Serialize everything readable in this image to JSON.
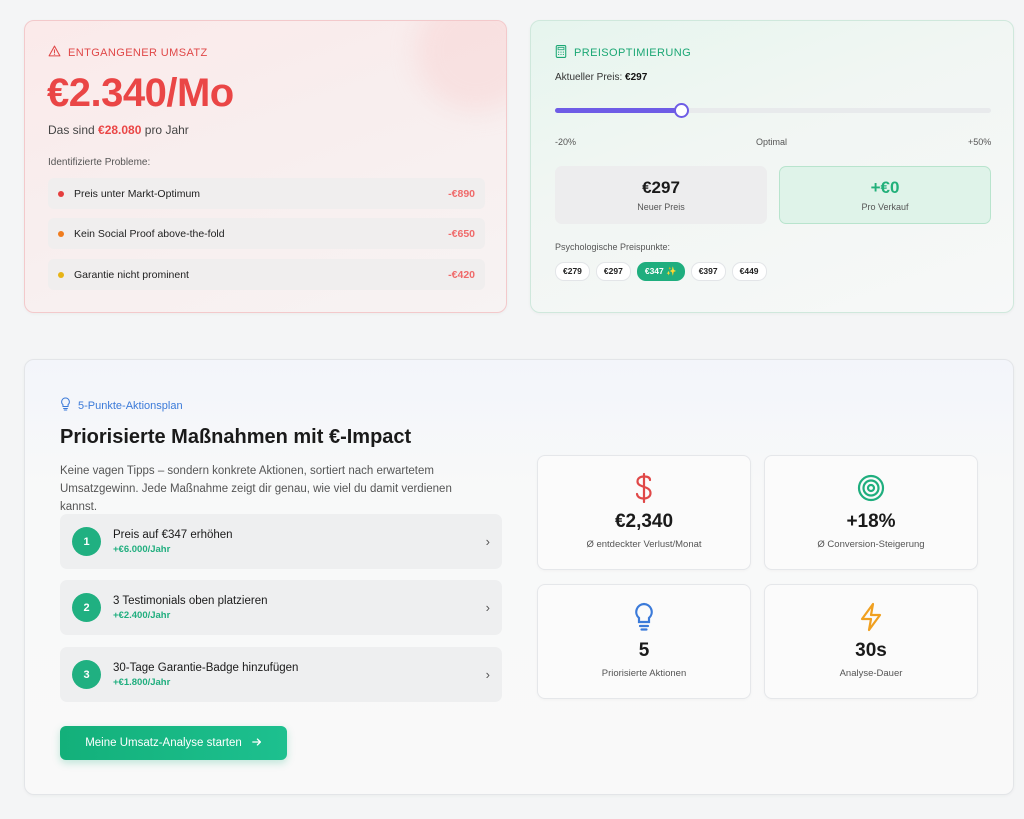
{
  "lost_revenue": {
    "heading": "ENTGANGENER UMSATZ",
    "amount": "€2.340/Mo",
    "sub_prefix": "Das sind",
    "sub_amount": "€28.080",
    "sub_suffix": "pro Jahr",
    "problems_label": "Identifizierte Probleme:",
    "problems": [
      {
        "label": "Preis unter Markt-Optimum",
        "amount": "-€890",
        "color": "#e53e3e"
      },
      {
        "label": "Kein Social Proof above-the-fold",
        "amount": "-€650",
        "color": "#f07c1e"
      },
      {
        "label": "Garantie nicht prominent",
        "amount": "-€420",
        "color": "#e7b416"
      }
    ]
  },
  "price_optimization": {
    "heading": "PREISOPTIMIERUNG",
    "current_label": "Aktueller Preis:",
    "current_value": "€297",
    "slider_value": 0.29,
    "slider_min_label": "-20%",
    "slider_mid_label": "Optimal",
    "slider_max_label": "+50%",
    "new_price": {
      "value": "€297",
      "label": "Neuer Preis"
    },
    "per_sale": {
      "value": "+€0",
      "label": "Pro Verkauf"
    },
    "psy_label": "Psychologische Preispunkte:",
    "psy_points": [
      "€279",
      "€297",
      "€347 ✨",
      "€397",
      "€449"
    ],
    "psy_active_index": 2
  },
  "action_plan": {
    "tag": "5-Punkte-Aktionsplan",
    "title": "Priorisierte Maßnahmen mit €-Impact",
    "description": "Keine vagen Tipps – sondern konkrete Aktionen, sortiert nach erwartetem Umsatzgewinn. Jede Maßnahme zeigt dir genau, wie viel du damit verdienen kannst.",
    "actions": [
      {
        "num": "1",
        "title": "Preis auf €347 erhöhen",
        "impact": "+€6.000/Jahr"
      },
      {
        "num": "2",
        "title": "3 Testimonials oben platzieren",
        "impact": "+€2.400/Jahr"
      },
      {
        "num": "3",
        "title": "30-Tage Garantie-Badge hinzufügen",
        "impact": "+€1.800/Jahr"
      }
    ],
    "cta_label": "Meine Umsatz-Analyse starten",
    "stats": [
      {
        "icon": "dollar-icon",
        "value": "€2,340",
        "label": "Ø entdeckter Verlust/Monat",
        "color": "#e04848"
      },
      {
        "icon": "target-icon",
        "value": "+18%",
        "label": "Ø Conversion-Steigerung",
        "color": "#1fae7e"
      },
      {
        "icon": "lightbulb-icon",
        "value": "5",
        "label": "Priorisierte Aktionen",
        "color": "#3b7ad9"
      },
      {
        "icon": "lightning-icon",
        "value": "30s",
        "label": "Analyse-Dauer",
        "color": "#f0a020"
      }
    ]
  }
}
